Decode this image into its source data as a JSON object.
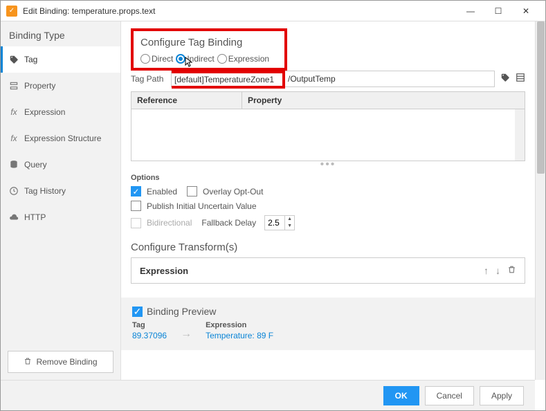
{
  "window": {
    "title": "Edit Binding: temperature.props.text"
  },
  "sidebar": {
    "heading": "Binding Type",
    "items": [
      {
        "label": "Tag"
      },
      {
        "label": "Property"
      },
      {
        "label": "Expression"
      },
      {
        "label": "Expression Structure"
      },
      {
        "label": "Query"
      },
      {
        "label": "Tag History"
      },
      {
        "label": "HTTP"
      }
    ],
    "remove": "Remove Binding"
  },
  "config": {
    "title": "Configure Tag Binding",
    "radios": {
      "direct": "Direct",
      "indirect": "Indirect",
      "expression": "Expression"
    },
    "tag_path_label": "Tag Path",
    "tag_path_prefix": "[default]TemperatureZone1",
    "tag_path_suffix": "/OutputTemp"
  },
  "ref_table": {
    "col1": "Reference",
    "col2": "Property"
  },
  "options": {
    "title": "Options",
    "enabled": "Enabled",
    "overlay": "Overlay Opt-Out",
    "publish": "Publish Initial Uncertain Value",
    "bidir": "Bidirectional",
    "fallback": "Fallback Delay",
    "fallback_value": "2.5"
  },
  "transforms": {
    "title": "Configure Transform(s)",
    "expression": "Expression"
  },
  "preview": {
    "title": "Binding Preview",
    "tag_label": "Tag",
    "tag_value": "89.37096",
    "expr_label": "Expression",
    "expr_value": "Temperature: 89 F"
  },
  "footer": {
    "ok": "OK",
    "cancel": "Cancel",
    "apply": "Apply"
  }
}
